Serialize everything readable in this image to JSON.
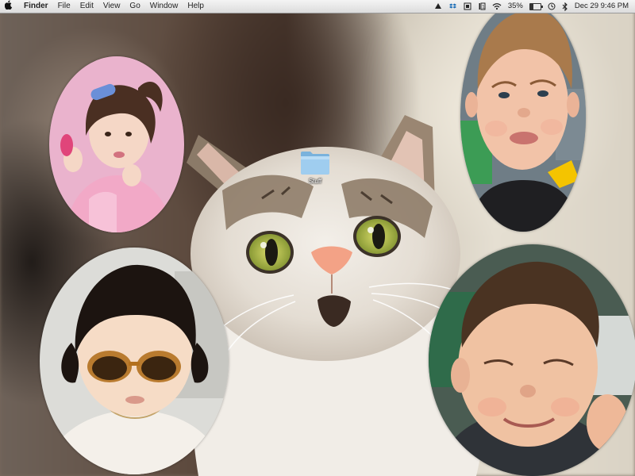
{
  "menubar": {
    "apple_icon": "apple-logo-icon",
    "app_name": "Finder",
    "items": [
      "File",
      "Edit",
      "View",
      "Go",
      "Window",
      "Help"
    ],
    "status": {
      "icons": [
        "upload-icon",
        "dropbox-icon",
        "scan-icon",
        "one-password-icon",
        "wifi-icon"
      ],
      "battery_percent": "35%",
      "battery_level": 0.35,
      "datetime": "Dec 29  9:46 PM"
    }
  },
  "desktop": {
    "folder": {
      "label": "Stuff",
      "icon": "folder-icon"
    }
  },
  "wallpaper": {
    "description_icon": "cat-wallpaper"
  },
  "colors": {
    "menubar": "#e4e4e4",
    "folder": "#8ec3e6",
    "cat_eye": "#b7c24a",
    "cat_nose": "#f3a286"
  }
}
